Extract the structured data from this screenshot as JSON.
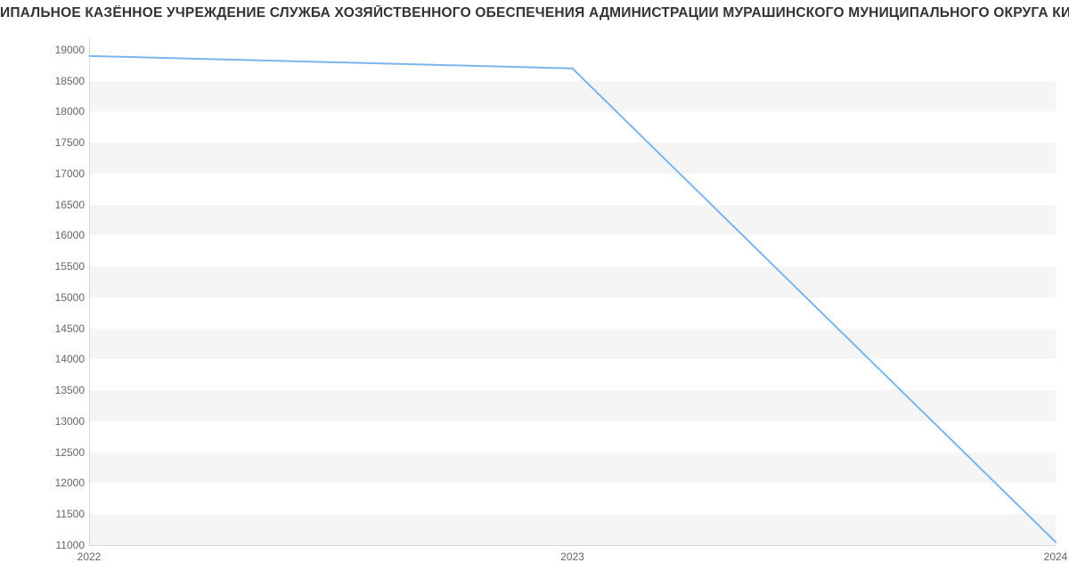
{
  "chart_data": {
    "type": "line",
    "title": "ИПАЛЬНОЕ КАЗЁННОЕ УЧРЕЖДЕНИЕ СЛУЖБА ХОЗЯЙСТВЕННОГО ОБЕСПЕЧЕНИЯ АДМИНИСТРАЦИИ МУРАШИНСКОГО МУНИЦИПАЛЬНОГО ОКРУГА КИРОВСКОЙ ОБЛАСТИ | ",
    "x": [
      2022,
      2023,
      2024
    ],
    "series": [
      {
        "name": "value",
        "values": [
          18900,
          18700,
          11050
        ]
      }
    ],
    "x_ticks": [
      2022,
      2023,
      2024
    ],
    "y_ticks": [
      11000,
      11500,
      12000,
      12500,
      13000,
      13500,
      14000,
      14500,
      15000,
      15500,
      16000,
      16500,
      17000,
      17500,
      18000,
      18500,
      19000
    ],
    "xlim": [
      2022,
      2024
    ],
    "ylim": [
      11000,
      19200
    ],
    "xlabel": "",
    "ylabel": "",
    "line_color": "#7cb5ec",
    "band_color": "#f5f5f5"
  }
}
